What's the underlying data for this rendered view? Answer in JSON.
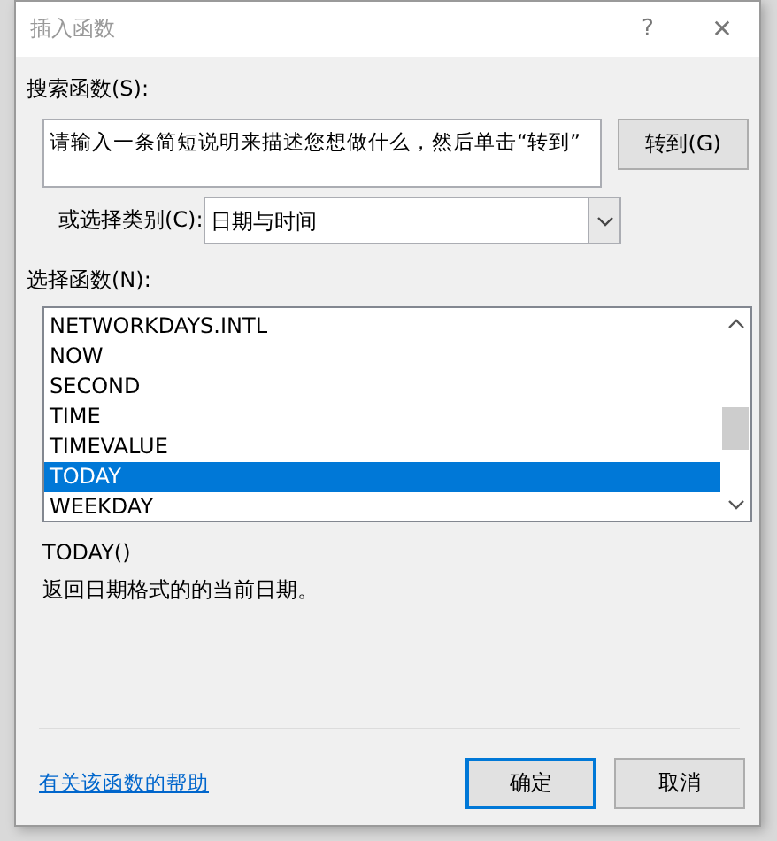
{
  "window": {
    "title": "插入函数",
    "help_glyph": "?",
    "close_glyph": "✕"
  },
  "search": {
    "label": "搜索函数(S):",
    "placeholder": "请输入一条简短说明来描述您想做什么，然后单击“转到”",
    "button": "转到(G)"
  },
  "category": {
    "label": "或选择类别(C):",
    "value": "日期与时间"
  },
  "functions": {
    "label": "选择函数(N):",
    "items": [
      {
        "name": "NETWORKDAYS.INTL",
        "selected": false
      },
      {
        "name": "NOW",
        "selected": false
      },
      {
        "name": "SECOND",
        "selected": false
      },
      {
        "name": "TIME",
        "selected": false
      },
      {
        "name": "TIMEVALUE",
        "selected": false
      },
      {
        "name": "TODAY",
        "selected": true
      },
      {
        "name": "WEEKDAY",
        "selected": false
      }
    ]
  },
  "signature": "TODAY()",
  "description": "返回日期格式的的当前日期。",
  "help_link": "有关该函数的帮助",
  "buttons": [
    {
      "label": "确定",
      "default": true
    },
    {
      "label": "取消",
      "default": false
    }
  ]
}
